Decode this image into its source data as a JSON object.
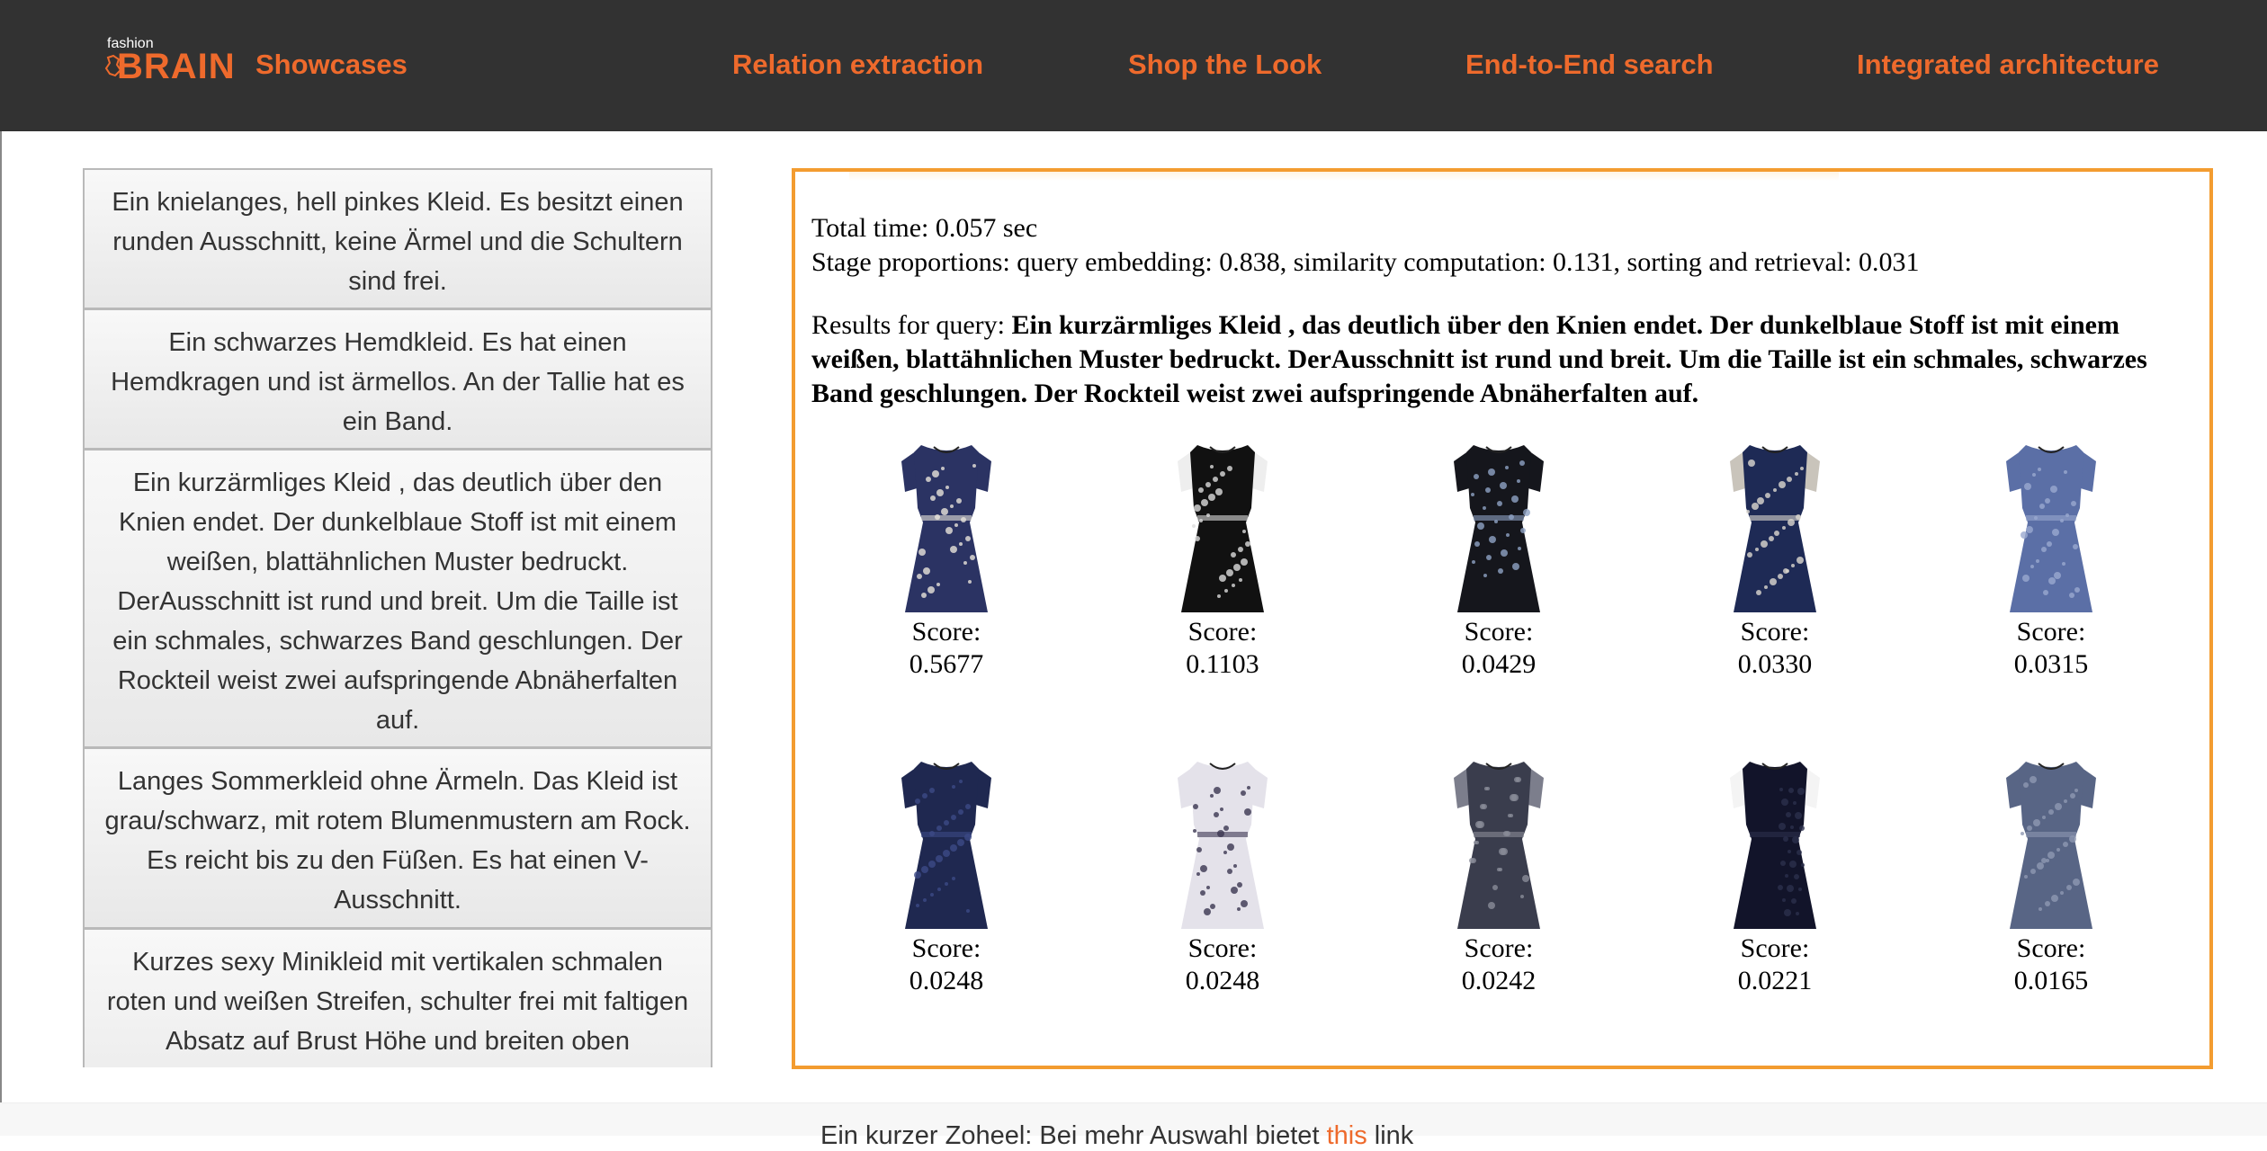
{
  "nav": {
    "brand_small": "fashion",
    "brand_large": "BRAIN",
    "showcases": "Showcases",
    "links": [
      "Relation extraction",
      "Shop the Look",
      "End-to-End search",
      "Integrated architecture"
    ]
  },
  "descriptions": [
    "Ein knielanges, hell pinkes Kleid. Es besitzt einen runden Ausschnitt, keine Ärmel und die Schultern sind frei.",
    "Ein schwarzes Hemdkleid. Es hat einen Hemdkragen und ist ärmellos. An der Tallie hat es ein Band.",
    "Ein kurzärmliges Kleid , das deutlich über den Knien endet. Der dunkelblaue Stoff ist mit einem weißen, blattähnlichen Muster bedruckt. DerAusschnitt ist rund und breit. Um die Taille ist ein schmales, schwarzes Band geschlungen. Der Rockteil weist zwei aufspringende Abnäherfalten auf.",
    "Langes Sommerkleid ohne Ärmeln. Das Kleid ist grau/schwarz, mit rotem Blumenmustern am Rock. Es reicht bis zu den Füßen. Es hat einen V-Ausschnitt.",
    "Kurzes sexy Minikleid mit vertikalen schmalen roten und weißen Streifen, schulter frei mit faltigen Absatz auf Brust Höhe und breiten oben"
  ],
  "results": {
    "total_time": "Total time: 0.057 sec",
    "stage_proportions": "Stage proportions: query embedding: 0.838, similarity computation: 0.131, sorting and retrieval: 0.031",
    "query_prefix": "Results for query: ",
    "query_text": "Ein kurzärmliges Kleid , das deutlich über den Knien endet. Der dunkelblaue Stoff ist mit einem weißen, blattähnlichen Muster bedruckt. DerAusschnitt ist rund und breit. Um die Taille ist ein schmales, schwarzes Band geschlungen. Der Rockteil weist zwei aufspringende Abnäherfalten auf.",
    "score_label": "Score:",
    "items": [
      {
        "score": "0.5677",
        "colors": {
          "body": "#2b3363",
          "pattern": "#e8e4da",
          "sleeve": "#2b3363"
        }
      },
      {
        "score": "0.1103",
        "colors": {
          "body": "#111111",
          "pattern": "#dcdcdc",
          "sleeve": "#eeeeee"
        }
      },
      {
        "score": "0.0429",
        "colors": {
          "body": "#15161c",
          "pattern": "#8fa3c4",
          "sleeve": "#15161c"
        }
      },
      {
        "score": "0.0330",
        "colors": {
          "body": "#1e2a55",
          "pattern": "#dcd8cf",
          "sleeve": "#c9c4bb"
        }
      },
      {
        "score": "0.0315",
        "colors": {
          "body": "#5b6fa6",
          "pattern": "#9aa9cf",
          "sleeve": "#5b6fa6"
        }
      },
      {
        "score": "0.0248",
        "colors": {
          "body": "#1f2850",
          "pattern": "#3c4a86",
          "sleeve": "#1f2850"
        }
      },
      {
        "score": "0.0248",
        "colors": {
          "body": "#e4e2ea",
          "pattern": "#3a3650",
          "sleeve": "#e4e2ea"
        }
      },
      {
        "score": "0.0242",
        "colors": {
          "body": "#3a3d4d",
          "pattern": "#8a8c98",
          "sleeve": "#7c7e8c"
        }
      },
      {
        "score": "0.0221",
        "colors": {
          "body": "#12142a",
          "pattern": "#2c2f4c",
          "sleeve": "#f4f4f4"
        }
      },
      {
        "score": "0.0165",
        "colors": {
          "body": "#586585",
          "pattern": "#8e98b2",
          "sleeve": "#586585"
        }
      }
    ]
  },
  "footer": {
    "text_before": "Ein kurzer Zoheel: Bei mehr Auswahl bietet ",
    "link": "this",
    "text_after": " link"
  },
  "colors": {
    "accent": "#ee6a2c",
    "navbar": "#323232",
    "panel_border": "#f39c30"
  }
}
